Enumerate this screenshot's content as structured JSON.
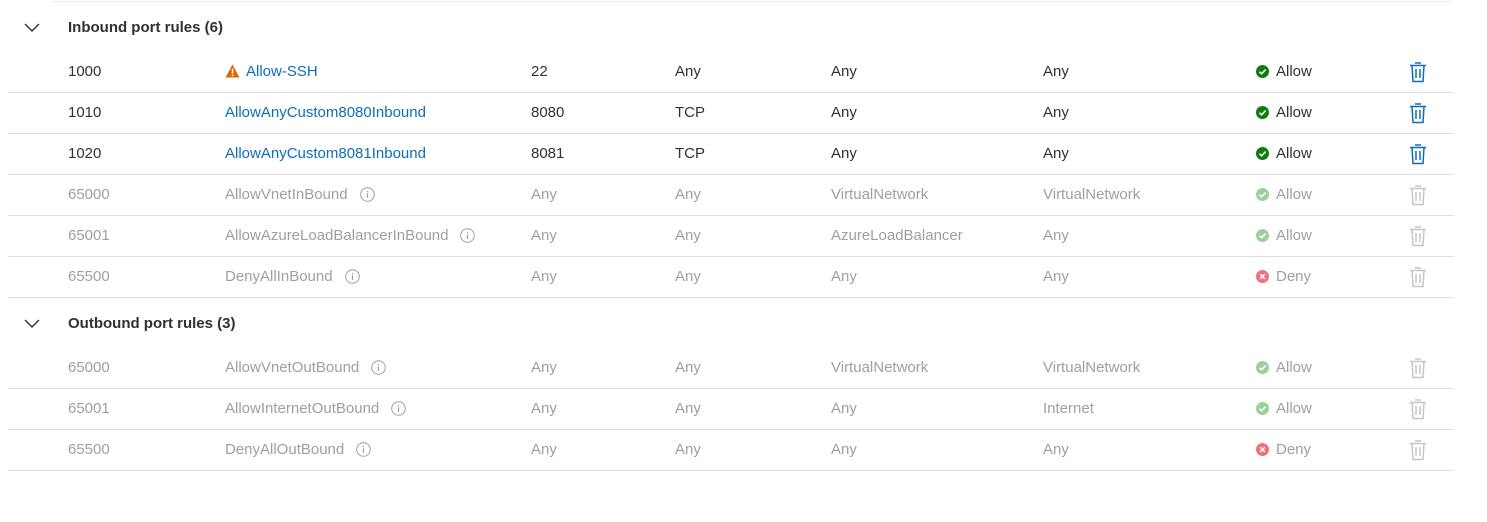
{
  "colors": {
    "link": "#0f6cbd",
    "allow_green": "#107c10",
    "allow_green_muted": "#9bd09b",
    "deny_red": "#f1707b",
    "warning_orange": "#d86b00",
    "delete_blue": "#0f6cbd",
    "muted_text": "#a19f9d"
  },
  "inbound": {
    "title": "Inbound port rules (6)",
    "rules": [
      {
        "priority": "1000",
        "name": "Allow-SSH",
        "port": "22",
        "protocol": "Any",
        "source": "Any",
        "destination": "Any",
        "action": "Allow",
        "is_default": false,
        "warning": true
      },
      {
        "priority": "1010",
        "name": "AllowAnyCustom8080Inbound",
        "port": "8080",
        "protocol": "TCP",
        "source": "Any",
        "destination": "Any",
        "action": "Allow",
        "is_default": false,
        "warning": false
      },
      {
        "priority": "1020",
        "name": "AllowAnyCustom8081Inbound",
        "port": "8081",
        "protocol": "TCP",
        "source": "Any",
        "destination": "Any",
        "action": "Allow",
        "is_default": false,
        "warning": false
      },
      {
        "priority": "65000",
        "name": "AllowVnetInBound",
        "port": "Any",
        "protocol": "Any",
        "source": "VirtualNetwork",
        "destination": "VirtualNetwork",
        "action": "Allow",
        "is_default": true,
        "warning": false
      },
      {
        "priority": "65001",
        "name": "AllowAzureLoadBalancerInBound",
        "port": "Any",
        "protocol": "Any",
        "source": "AzureLoadBalancer",
        "destination": "Any",
        "action": "Allow",
        "is_default": true,
        "warning": false
      },
      {
        "priority": "65500",
        "name": "DenyAllInBound",
        "port": "Any",
        "protocol": "Any",
        "source": "Any",
        "destination": "Any",
        "action": "Deny",
        "is_default": true,
        "warning": false
      }
    ]
  },
  "outbound": {
    "title": "Outbound port rules (3)",
    "rules": [
      {
        "priority": "65000",
        "name": "AllowVnetOutBound",
        "port": "Any",
        "protocol": "Any",
        "source": "VirtualNetwork",
        "destination": "VirtualNetwork",
        "action": "Allow",
        "is_default": true,
        "warning": false
      },
      {
        "priority": "65001",
        "name": "AllowInternetOutBound",
        "port": "Any",
        "protocol": "Any",
        "source": "Any",
        "destination": "Internet",
        "action": "Allow",
        "is_default": true,
        "warning": false
      },
      {
        "priority": "65500",
        "name": "DenyAllOutBound",
        "port": "Any",
        "protocol": "Any",
        "source": "Any",
        "destination": "Any",
        "action": "Deny",
        "is_default": true,
        "warning": false
      }
    ]
  },
  "icons": {
    "collapse": "chevron-down-icon",
    "warning": "warning-icon",
    "info": "info-icon",
    "allow": "check-circle-icon",
    "deny": "x-circle-icon",
    "delete": "trash-icon"
  }
}
